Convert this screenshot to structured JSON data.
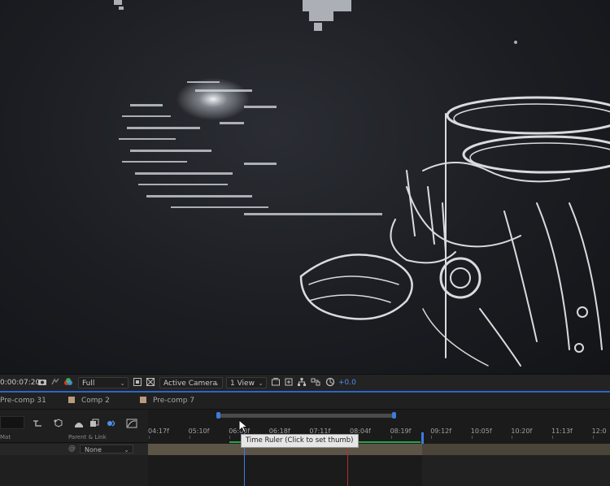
{
  "viewer_toolbar": {
    "timecode": "0:00:07:20",
    "resolution": "Full",
    "camera": "Active Camera",
    "view": "1 View",
    "exposure": "+0.0"
  },
  "tabs": [
    {
      "label": "Pre-comp 31"
    },
    {
      "label": "Comp 2"
    },
    {
      "label": "Pre-comp 7"
    }
  ],
  "timeline": {
    "column_headers": {
      "mat": "Mat",
      "parent": "Parent & Link"
    },
    "layer": {
      "parent_value": "None"
    },
    "ruler_ticks": [
      "04:17f",
      "05:10f",
      "06:03f",
      "06:18f",
      "07:11f",
      "08:04f",
      "08:19f",
      "09:12f",
      "10:05f",
      "10:20f",
      "11:13f",
      "12:0"
    ],
    "tooltip": "Time Ruler (Click to set thumb)"
  },
  "colors": {
    "accent": "#2a66c8",
    "layer_bar": "#5c5447",
    "label_swatch": "#b99b7b"
  }
}
